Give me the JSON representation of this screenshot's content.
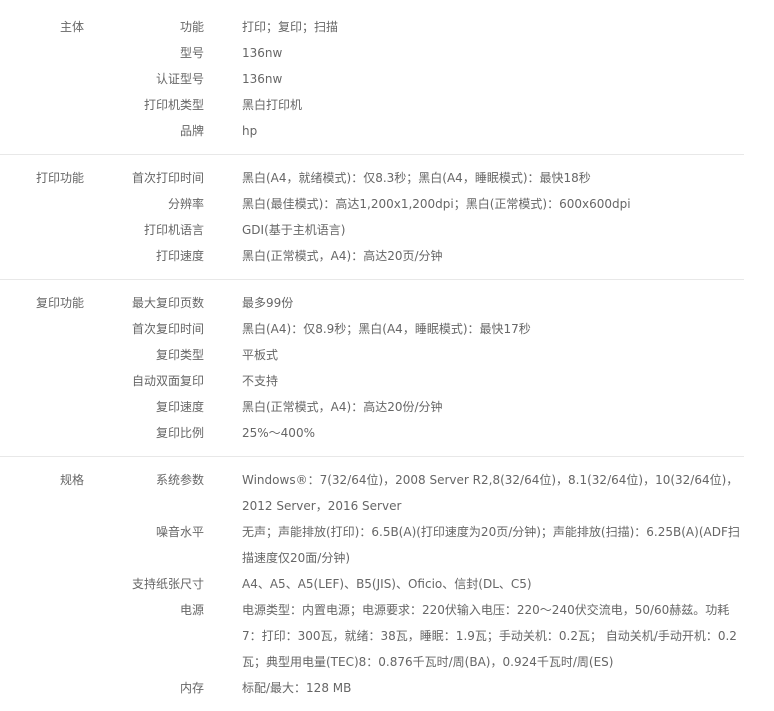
{
  "groups": [
    {
      "label": "主体",
      "rows": [
        {
          "key": "功能",
          "value": "打印；复印；扫描"
        },
        {
          "key": "型号",
          "value": "136nw"
        },
        {
          "key": "认证型号",
          "value": "136nw"
        },
        {
          "key": "打印机类型",
          "value": "黑白打印机"
        },
        {
          "key": "品牌",
          "value": "hp"
        }
      ]
    },
    {
      "label": "打印功能",
      "rows": [
        {
          "key": "首次打印时间",
          "value": "黑白(A4，就绪模式)：仅8.3秒；黑白(A4，睡眠模式)：最快18秒"
        },
        {
          "key": "分辨率",
          "value": "黑白(最佳模式)：高达1,200x1,200dpi；黑白(正常模式)：600x600dpi"
        },
        {
          "key": "打印机语言",
          "value": "GDI(基于主机语言)"
        },
        {
          "key": "打印速度",
          "value": "黑白(正常模式，A4)：高达20页/分钟"
        }
      ]
    },
    {
      "label": "复印功能",
      "rows": [
        {
          "key": "最大复印页数",
          "value": "最多99份"
        },
        {
          "key": "首次复印时间",
          "value": "黑白(A4)：仅8.9秒；黑白(A4，睡眠模式)：最快17秒"
        },
        {
          "key": "复印类型",
          "value": "平板式"
        },
        {
          "key": "自动双面复印",
          "value": "不支持"
        },
        {
          "key": "复印速度",
          "value": "黑白(正常模式，A4)：高达20份/分钟"
        },
        {
          "key": "复印比例",
          "value": "25%～400%"
        }
      ]
    },
    {
      "label": "规格",
      "rows": [
        {
          "key": "系统参数",
          "value": "Windows®：7(32/64位)，2008 Server R2,8(32/64位)，8.1(32/64位)，10(32/64位)，2012 Server，2016 Server"
        },
        {
          "key": "噪音水平",
          "value": "无声；声能排放(打印)：6.5B(A)(打印速度为20页/分钟)；声能排放(扫描)：6.25B(A)(ADF扫描速度仅20面/分钟)"
        },
        {
          "key": "支持纸张尺寸",
          "value": "A4、A5、A5(LEF)、B5(JIS)、Oficio、信封(DL、C5)"
        },
        {
          "key": "电源",
          "value": "电源类型：内置电源；电源要求：220伏输入电压：220～240伏交流电，50/60赫兹。功耗7：打印：300瓦，就绪：38瓦，睡眠：1.9瓦；手动关机：0.2瓦； 自动关机/手动开机：0.2瓦；典型用电量(TEC)8：0.876千瓦时/周(BA)，0.924千瓦时/周(ES)"
        },
        {
          "key": "内存",
          "value": "标配/最大：128 MB"
        }
      ]
    }
  ]
}
